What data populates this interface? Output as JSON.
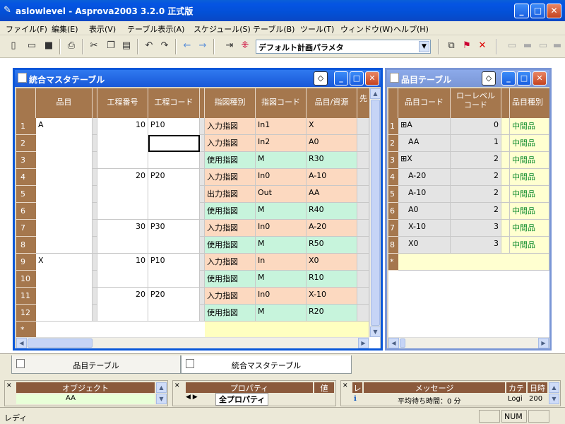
{
  "app": {
    "title": "aslowlevel - Asprova2003 3.2.0 正式版"
  },
  "menu": [
    "ファイル(F)",
    "編集(E)",
    "表示(V)",
    "テーブル表示(A)",
    "スケジュール(S)",
    "テーブル(B)",
    "ツール(T)",
    "ウィンドウ(W)",
    "ヘルプ(H)"
  ],
  "toolbar": {
    "combo_value": "デフォルト計画パラメタ"
  },
  "left_window": {
    "title": "統合マスタテーブル",
    "headers": [
      "品目",
      "工程番号",
      "工程コード",
      "指図種別",
      "指図コード",
      "品目/資源",
      "先"
    ],
    "rows": [
      {
        "n": "1",
        "item": "A",
        "proc_no": "10",
        "proc_code": "P10",
        "kind": "入力指図",
        "code": "In1",
        "res": "X",
        "k": "in"
      },
      {
        "n": "2",
        "item": "",
        "proc_no": "",
        "proc_code": "",
        "kind": "入力指図",
        "code": "In2",
        "res": "A0",
        "k": "in"
      },
      {
        "n": "3",
        "item": "",
        "proc_no": "",
        "proc_code": "",
        "kind": "使用指図",
        "code": "M",
        "res": "R30",
        "k": "use"
      },
      {
        "n": "4",
        "item": "",
        "proc_no": "20",
        "proc_code": "P20",
        "kind": "入力指図",
        "code": "In0",
        "res": "A-10",
        "k": "in"
      },
      {
        "n": "5",
        "item": "",
        "proc_no": "",
        "proc_code": "",
        "kind": "出力指図",
        "code": "Out",
        "res": "AA",
        "k": "in"
      },
      {
        "n": "6",
        "item": "",
        "proc_no": "",
        "proc_code": "",
        "kind": "使用指図",
        "code": "M",
        "res": "R40",
        "k": "use"
      },
      {
        "n": "7",
        "item": "",
        "proc_no": "30",
        "proc_code": "P30",
        "kind": "入力指図",
        "code": "In0",
        "res": "A-20",
        "k": "in"
      },
      {
        "n": "8",
        "item": "",
        "proc_no": "",
        "proc_code": "",
        "kind": "使用指図",
        "code": "M",
        "res": "R50",
        "k": "use"
      },
      {
        "n": "9",
        "item": "X",
        "proc_no": "10",
        "proc_code": "P10",
        "kind": "入力指図",
        "code": "In",
        "res": "X0",
        "k": "in"
      },
      {
        "n": "10",
        "item": "",
        "proc_no": "",
        "proc_code": "",
        "kind": "使用指図",
        "code": "M",
        "res": "R10",
        "k": "use"
      },
      {
        "n": "11",
        "item": "",
        "proc_no": "20",
        "proc_code": "P20",
        "kind": "入力指図",
        "code": "In0",
        "res": "X-10",
        "k": "in"
      },
      {
        "n": "12",
        "item": "",
        "proc_no": "",
        "proc_code": "",
        "kind": "使用指図",
        "code": "M",
        "res": "R20",
        "k": "use"
      }
    ],
    "new_row_marker": "*"
  },
  "right_window": {
    "title": "品目テーブル",
    "headers": [
      "品目コード",
      "ローレベル\nコード",
      "品目種別"
    ],
    "rows": [
      {
        "n": "1",
        "code": "A",
        "plus": true,
        "level": "0",
        "kind": "中間品"
      },
      {
        "n": "2",
        "code": "AA",
        "plus": false,
        "level": "1",
        "kind": "中間品"
      },
      {
        "n": "3",
        "code": "X",
        "plus": true,
        "level": "2",
        "kind": "中間品"
      },
      {
        "n": "4",
        "code": "A-20",
        "plus": false,
        "level": "2",
        "kind": "中間品"
      },
      {
        "n": "5",
        "code": "A-10",
        "plus": false,
        "level": "2",
        "kind": "中間品"
      },
      {
        "n": "6",
        "code": "A0",
        "plus": false,
        "level": "2",
        "kind": "中間品"
      },
      {
        "n": "7",
        "code": "X-10",
        "plus": false,
        "level": "3",
        "kind": "中間品"
      },
      {
        "n": "8",
        "code": "X0",
        "plus": false,
        "level": "3",
        "kind": "中間品"
      }
    ],
    "new_row_marker": "*"
  },
  "tabs": [
    "品目テーブル",
    "統合マスタテーブル"
  ],
  "panes": {
    "object": {
      "header": "オブジェクト",
      "item": "AA"
    },
    "property": {
      "header": "プロパティ",
      "header2": "値",
      "tab": "全プロパティ"
    },
    "message": {
      "h1": "レ",
      "h2": "メッセージ",
      "h3": "カテ",
      "h4": "日時",
      "row_msg": "平均待ち時間：0 分",
      "row_cat": "Logi",
      "row_time": "200"
    }
  },
  "status": {
    "text": "レディ",
    "num": "NUM"
  }
}
